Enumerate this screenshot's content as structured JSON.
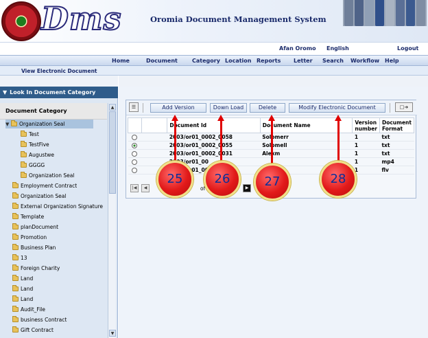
{
  "header": {
    "logo_text": "Dms",
    "title": "Oromia Document Management System",
    "languages": [
      "Afan Oromo",
      "English"
    ],
    "logout": "Logout"
  },
  "nav": [
    "Home",
    "Document",
    "Category",
    "Location",
    "Reports",
    "Letter",
    "Search",
    "Workflow",
    "Help"
  ],
  "subnav": {
    "label": "View Electronic Document"
  },
  "left_panel": {
    "header": "Look In Document Category",
    "title": "Document Category",
    "selected": "Organization Seal",
    "children": [
      "Test",
      "TestFive",
      "Augustwe",
      "GGGG",
      "Organization Seal"
    ],
    "items": [
      "Employment Contract",
      "Organization Seal",
      "External Organization Signature",
      "Template",
      "planDocument",
      "Promotion",
      "Business Plan",
      "13",
      "Foreign Charity",
      "Land",
      "Land",
      "Land",
      "Audit_File",
      "business Contract",
      "Gift Contract"
    ]
  },
  "toolbar": {
    "add_version": "Add Version",
    "download": "Down Load",
    "delete": "Delete",
    "modify": "Modify Electronic Document"
  },
  "grid": {
    "columns": [
      "Document Id",
      "Document Name",
      "Version number",
      "Document Format"
    ],
    "rows": [
      {
        "id": "2003/or01_0002_0058",
        "name": "Solomerr",
        "version": "1",
        "format": "txt",
        "selected": false
      },
      {
        "id": "2003/or01_0002_0055",
        "name": "Solomell",
        "version": "1",
        "format": "txt",
        "selected": true
      },
      {
        "id": "2003/or01_0002_0031",
        "name": "Alexm",
        "version": "1",
        "format": "txt",
        "selected": false
      },
      {
        "id": "2003/or01_00",
        "name": "",
        "version": "1",
        "format": "mp4",
        "selected": false
      },
      {
        "id": "2003/or01_00",
        "name": "",
        "version": "1",
        "format": "flv",
        "selected": false
      }
    ]
  },
  "pager": {
    "of_text": "of"
  },
  "callouts": [
    "25",
    "26",
    "27",
    "28"
  ],
  "colors": {
    "nav_text": "#1a2a6a",
    "panel_header": "#2f5c8a",
    "callout_red": "#e21a1a",
    "callout_number": "#0b2f9a",
    "arrow": "#e00000"
  }
}
